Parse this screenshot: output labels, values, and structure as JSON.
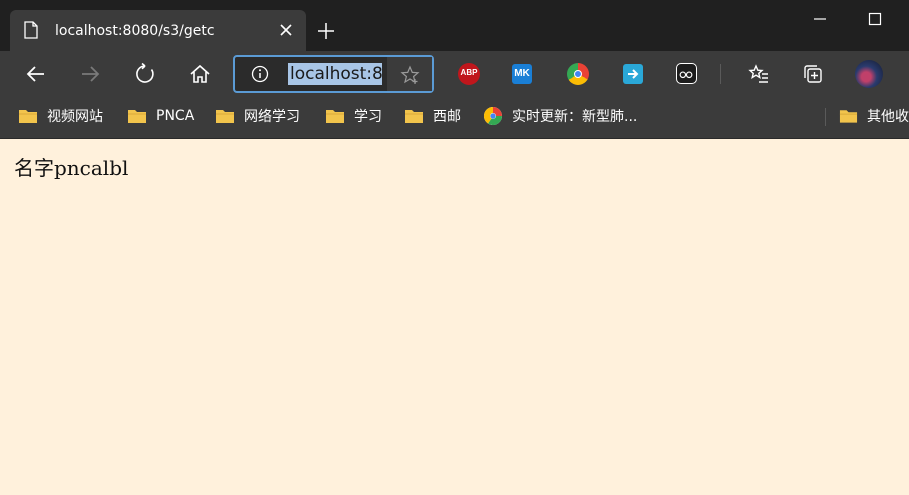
{
  "tab": {
    "title": "localhost:8080/s3/getc",
    "icon": "page-icon"
  },
  "address_bar": {
    "text": "localhost:8"
  },
  "toolbar": {
    "icons": [
      "back-icon",
      "forward-icon",
      "refresh-icon",
      "home-icon",
      "favorite-star-icon",
      "favorites-list-icon",
      "collections-icon",
      "profile-avatar"
    ],
    "extensions": [
      "ABP",
      "MK"
    ]
  },
  "bookmarks": [
    {
      "label": "视频网站",
      "icon": "folder-icon"
    },
    {
      "label": "PNCA",
      "icon": "folder-icon"
    },
    {
      "label": "网络学习",
      "icon": "folder-icon"
    },
    {
      "label": "学习",
      "icon": "folder-icon"
    },
    {
      "label": "西邮",
      "icon": "folder-icon"
    },
    {
      "label": "实时更新：新型肺...",
      "icon": "site-icon"
    },
    {
      "label": "其他收",
      "icon": "folder-icon"
    }
  ],
  "page": {
    "text": "名字pncalbl"
  },
  "colors": {
    "page_bg": "#fff1dc",
    "chrome_bg": "#3b3b3b",
    "titlebar_bg": "#202020",
    "accent": "#5b9bd5",
    "folder": "#f2c44c"
  }
}
